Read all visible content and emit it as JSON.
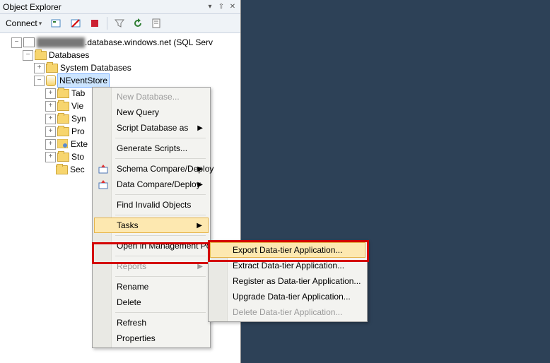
{
  "panel": {
    "title": "Object Explorer"
  },
  "toolbar": {
    "connect": "Connect"
  },
  "tree": {
    "server": ".database.windows.net (SQL Serv",
    "server_blur": "████████",
    "databases": "Databases",
    "sysdb": "System Databases",
    "selected": "NEventStore",
    "children": {
      "tables": "Tab",
      "views": "Vie",
      "synonyms": "Syn",
      "programmability": "Pro",
      "extended": "Exte",
      "storage": "Sto",
      "security": "Sec"
    }
  },
  "menu": {
    "new_database": "New Database...",
    "new_query": "New Query",
    "script_db": "Script Database as",
    "gen_scripts": "Generate Scripts...",
    "schema_cd": "Schema Compare/Deploy",
    "data_cd": "Data Compare/Deploy",
    "find_invalid": "Find Invalid Objects",
    "tasks": "Tasks",
    "open_portal": "Open in Management Portal...",
    "reports": "Reports",
    "rename": "Rename",
    "delete": "Delete",
    "refresh": "Refresh",
    "properties": "Properties"
  },
  "submenu": {
    "export": "Export Data-tier Application...",
    "extract": "Extract Data-tier Application...",
    "register": "Register as Data-tier Application...",
    "upgrade": "Upgrade Data-tier Application...",
    "delete": "Delete Data-tier Application..."
  }
}
